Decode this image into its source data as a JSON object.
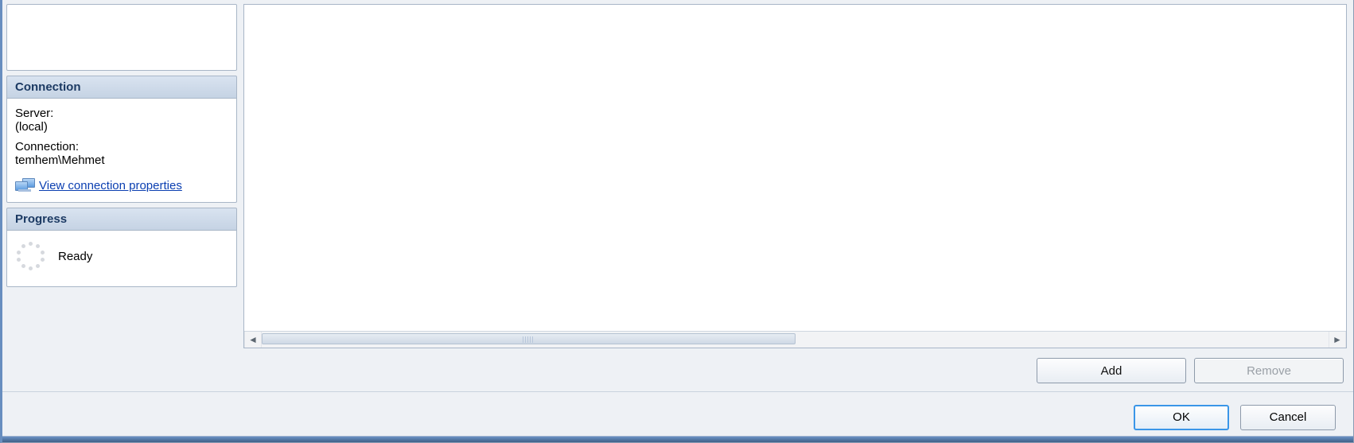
{
  "left_panel": {
    "connection_section": {
      "header": "Connection",
      "server_label": "Server:",
      "server_value": "(local)",
      "connection_label": "Connection:",
      "connection_value": "temhem\\Mehmet",
      "view_properties_link": "View connection properties"
    },
    "progress_section": {
      "header": "Progress",
      "status": "Ready"
    }
  },
  "main_panel": {
    "buttons": {
      "add": "Add",
      "remove": "Remove"
    }
  },
  "dialog_buttons": {
    "ok": "OK",
    "cancel": "Cancel"
  }
}
